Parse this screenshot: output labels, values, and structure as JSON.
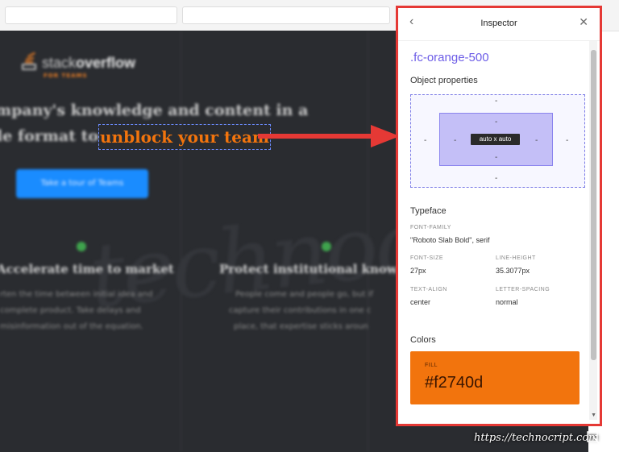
{
  "page": {
    "logo": {
      "name_light": "stack",
      "name_bold": "overflow",
      "subtitle": "FOR TEAMS"
    },
    "hero": {
      "line1": "mpany's knowledge and content in a",
      "line2_prefix": "le format to",
      "highlight": "unblock your team"
    },
    "cta_label": "Take a tour of Teams",
    "features": [
      {
        "title": "Accelerate time to market",
        "desc": [
          "rten the time between initial idea and",
          "complete product. Take delays and",
          "misinformation out of the equation."
        ]
      },
      {
        "title": "Protect institutional know",
        "desc": [
          "People come and people go, but if",
          "capture their contributions in one c",
          "place, that expertise sticks aroun"
        ]
      }
    ]
  },
  "inspector": {
    "title": "Inspector",
    "selector": ".fc-orange-500",
    "object_properties_title": "Object properties",
    "box_model": {
      "margin": "-",
      "padding": "-",
      "size": "auto x auto"
    },
    "typeface": {
      "title": "Typeface",
      "font_family_label": "FONT-FAMILY",
      "font_family_value": "\"Roboto Slab Bold\", serif",
      "font_size_label": "FONT-SIZE",
      "font_size_value": "27px",
      "line_height_label": "LINE-HEIGHT",
      "line_height_value": "35.3077px",
      "text_align_label": "TEXT-ALIGN",
      "text_align_value": "center",
      "letter_spacing_label": "LETTER-SPACING",
      "letter_spacing_value": "normal"
    },
    "colors": {
      "title": "Colors",
      "fill_label": "FILL",
      "fill_value": "#f2740d"
    }
  },
  "watermark_url": "https://technocript.com",
  "colors": {
    "highlight": "#f2740d",
    "panel_border": "#e53935",
    "selector": "#6c5ce7",
    "cta": "#1a8cff"
  }
}
